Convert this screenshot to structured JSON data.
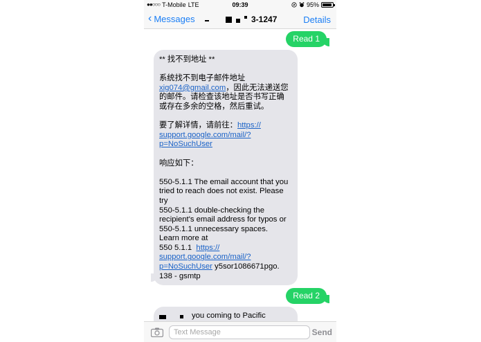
{
  "status_bar": {
    "signal": "●●○○○",
    "carrier": "T-Mobile",
    "network": "LTE",
    "time": "09:39",
    "battery_percent": "95%",
    "battery_level": 0.95
  },
  "nav": {
    "back_label": "Messages",
    "title_suffix": "3-1247",
    "details_label": "Details"
  },
  "messages": {
    "sent_1": "Read 1",
    "bounce": {
      "line_heading": "** 找不到地址 **",
      "line_1": "系统找不到电子邮件地址",
      "email_link": "xig074@gmail.com",
      "line_2_suffix": "，因此无法递送您",
      "line_3": "的邮件。请检查该地址是否书写正确",
      "line_4": "或存在多余的空格，然后重试。",
      "line_5": "要了解详情，请前往：",
      "link1_a": "https://",
      "link1_b": "support.google.com/mail/?",
      "link1_c": "p=NoSuchUser",
      "line_6": "响应如下：",
      "resp_1": "550-5.1.1 The email account that you",
      "resp_2": "tried to reach does not exist. Please",
      "resp_3": "try",
      "resp_4": "550-5.1.1 double-checking the",
      "resp_5": "recipient's email address for typos or",
      "resp_6": "550-5.1.1 unnecessary spaces.",
      "resp_7": "Learn more at",
      "resp_8_prefix": "550 5.1.1",
      "link2_a": "https://",
      "link2_b": "support.google.com/mail/?",
      "link2_c": "p=NoSuchUser",
      "resp_8_suffix": " y5sor1086671pgo.",
      "resp_9": "138 - gsmtp"
    },
    "sent_2": "Read 2",
    "received_2": "you coming to Pacific"
  },
  "input": {
    "placeholder": "Text Message",
    "send_label": "Send"
  },
  "icons": {
    "back": "chevron-left-icon",
    "camera": "camera-icon",
    "location": "location-arrow-icon",
    "alarm": "alarm-clock-icon"
  },
  "colors": {
    "accent": "#1a7ef5",
    "sent_bubble": "#25d366",
    "received_bubble": "#e5e5ea"
  }
}
